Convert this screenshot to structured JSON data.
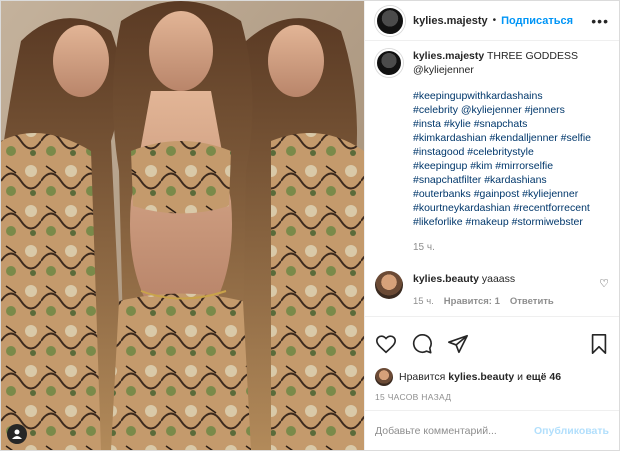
{
  "header": {
    "username": "kylies.majesty",
    "separator": "•",
    "follow_label": "Подписаться",
    "more_icon": "more-horizontal-icon"
  },
  "caption": {
    "username": "kylies.majesty",
    "text": "THREE GODDESS @kyliejenner",
    "hashtags": "#keepingupwithkardashains\n#celebrity @kyliejenner #jenners\n#insta #kylie #snapchats\n#kimkardashian #kendalljenner #selfie\n#instagood #celebritystyle\n#keepingup #kim #mirrorselfie\n#snapchatfilter #kardashians\n#outerbanks #gainpost #kyliejenner\n#kourtneykardashian #recentforrecent\n#likeforlike #makeup #stormiwebster",
    "time": "15 ч."
  },
  "comment": {
    "username": "kylies.beauty",
    "text": "yaaass",
    "time": "15 ч.",
    "likes": "Нравится: 1",
    "reply": "Ответить"
  },
  "likes_line": {
    "prefix": "Нравится",
    "user": "kylies.beauty",
    "middle": "и",
    "others": "ещё 46"
  },
  "date": "15 ЧАСОВ НАЗАД",
  "add_comment": {
    "placeholder": "Добавьте комментарий...",
    "publish_label": "Опубликовать"
  },
  "colors": {
    "accent": "#0095f6",
    "link": "#00376b",
    "muted": "#8e8e8e",
    "publish_disabled": "#b2dffc"
  }
}
